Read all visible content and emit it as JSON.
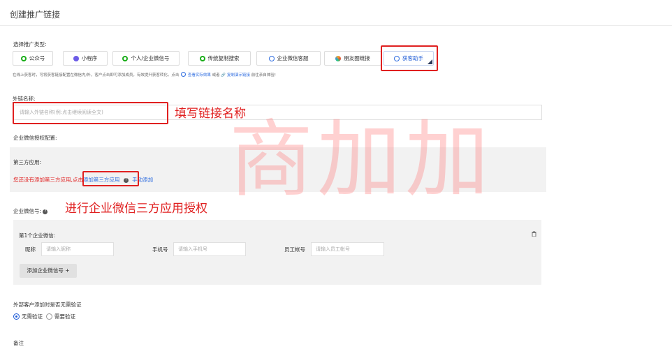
{
  "header": {
    "title": "创建推广链接"
  },
  "promo_type": {
    "label": "选择推广类型:",
    "options": [
      {
        "label": "公众号",
        "icon": "official-account-icon",
        "color": "#1aad19"
      },
      {
        "label": "小程序",
        "icon": "mini-program-icon",
        "color": "#6c5ce7"
      },
      {
        "label": "个人/企业微信号",
        "icon": "wechat-icon",
        "color": "#1aad19"
      },
      {
        "label": "传统复制搜索",
        "icon": "search-copy-icon",
        "color": "#1aad19"
      },
      {
        "label": "企业微信客服",
        "icon": "service-icon",
        "color": "#2f6de0"
      },
      {
        "label": "朋友圈链接",
        "icon": "moments-icon",
        "color": "#f5a623"
      },
      {
        "label": "获客助手",
        "icon": "acquisition-icon",
        "color": "#2f6de0",
        "selected": true
      }
    ],
    "hint_prefix": "在线上获客时，可将获客链接配置在微信内/外，客户点击即可添加成员，有效提升获客转化。点击",
    "hint_link1": "查看实际效果",
    "hint_or": "或者",
    "hint_link2": "复制演示链接",
    "hint_suffix": "前往亲自体验!"
  },
  "link_name": {
    "label": "外链名称:",
    "placeholder": "请输入外链名称(例:点击继续阅读全文)",
    "annotation": "填写链接名称"
  },
  "auth_config": {
    "label": "企业微信授权配置:",
    "third_party_label": "第三方应用:",
    "no_app_text": "您还没有添加第三方应用,",
    "click_prefix": "点击",
    "add_app_link": "添加第三方应用",
    "manual_add": "手动添加"
  },
  "watermark": "商加加",
  "wecom": {
    "label": "企业微信号:",
    "annotation": "进行企业微信三方应用授权",
    "item_title": "第1个企业微信:",
    "nickname_label": "昵称",
    "nickname_placeholder": "请输入昵称",
    "phone_label": "手机号",
    "phone_placeholder": "请输入手机号",
    "account_label": "员工帐号",
    "account_placeholder": "请输入员工帐号",
    "add_button": "添加企业微信号 +"
  },
  "verify": {
    "label": "外部客户添加时是否无需验证",
    "option_no": "无需验证",
    "option_yes": "需要验证"
  },
  "remarks": {
    "label": "备注"
  }
}
